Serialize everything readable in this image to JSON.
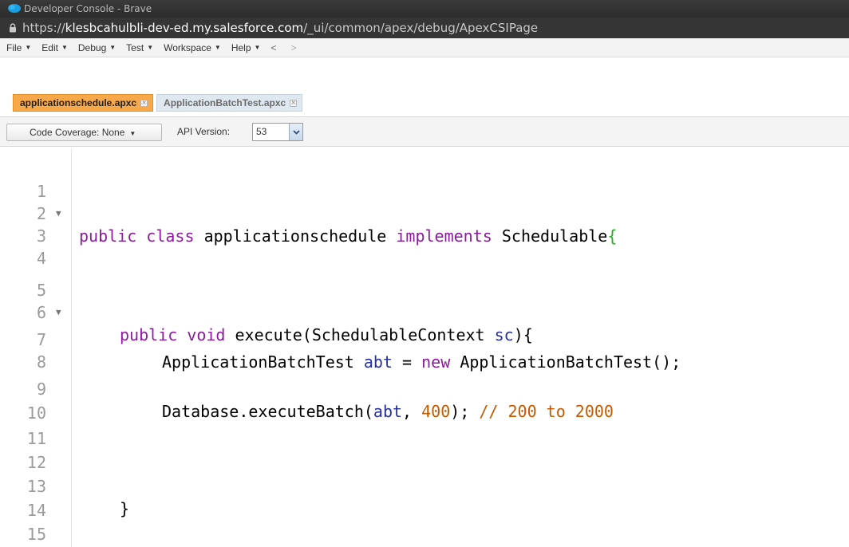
{
  "window": {
    "title": "Developer Console - Brave",
    "url_scheme": "https://",
    "url_host": "klesbcahulbli-dev-ed.my.salesforce.com",
    "url_path": "/_ui/common/apex/debug/ApexCSIPage"
  },
  "menu": {
    "items": [
      "File",
      "Edit",
      "Debug",
      "Test",
      "Workspace",
      "Help"
    ],
    "back": "<",
    "forward": ">"
  },
  "tabs": [
    {
      "label": "applicationschedule.apxc",
      "active": true
    },
    {
      "label": "ApplicationBatchTest.apxc",
      "active": false
    }
  ],
  "toolbar": {
    "coverage_label": "Code Coverage: None",
    "api_label": "API Version:",
    "api_value": "53"
  },
  "editor": {
    "line_numbers": [
      "1",
      "2",
      "3",
      "4",
      "5",
      "6",
      "7",
      "8",
      "9",
      "10",
      "11",
      "12",
      "13",
      "14",
      "15"
    ],
    "lines": {
      "l1_kw1": "public",
      "l1_kw2": "class",
      "l1_name": "applicationschedule",
      "l1_kw3": "implements",
      "l1_iface": "Schedulable",
      "l1_brace": "{",
      "l5_kw1": "public",
      "l5_kw2": "void",
      "l5_method": "execute(SchedulableContext",
      "l5_param": "sc",
      "l5_end": "){",
      "l7_type": "ApplicationBatchTest",
      "l7_var": "abt",
      "l7_eq": "=",
      "l7_new": "new",
      "l7_ctor": "ApplicationBatchTest();",
      "l9_call": "Database.executeBatch(",
      "l9_var": "abt",
      "l9_comma": ",",
      "l9_num": "400",
      "l9_end": ");",
      "l9_comment": "// 200 to 2000",
      "l13_brace": "}",
      "l15_brace": "}"
    }
  },
  "colors": {
    "keyword": "#8e1aa0",
    "identifier": "#25309c",
    "number": "#c45a00",
    "comment": "#c45a00",
    "active_tab": "#f7a94a"
  }
}
